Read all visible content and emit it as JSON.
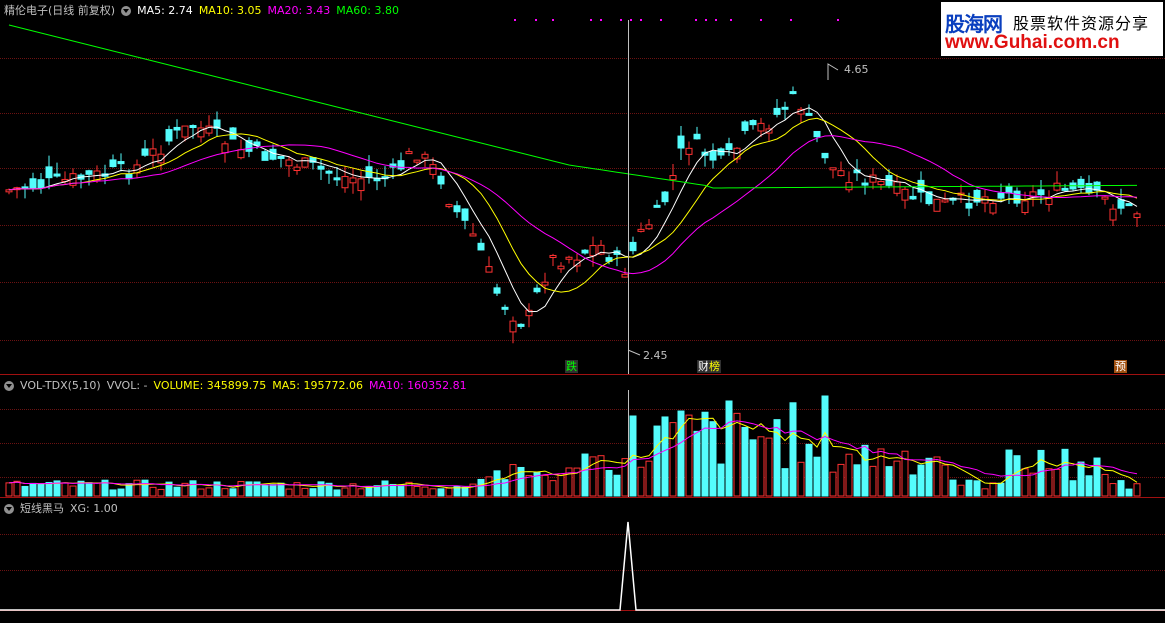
{
  "price_pane": {
    "stock_label": "精伦电子(日线 前复权)",
    "ma": [
      {
        "label": "MA5: 2.74",
        "color": "#ffffff"
      },
      {
        "label": "MA10: 3.05",
        "color": "#ffff00"
      },
      {
        "label": "MA20: 3.43",
        "color": "#ff00ff"
      },
      {
        "label": "MA60: 3.80",
        "color": "#00ff00"
      }
    ],
    "high_label": "4.65",
    "low_label": "2.45",
    "tags": [
      {
        "text": "跌",
        "color": "#00ff00"
      },
      {
        "text": "财",
        "color": "#ffffff"
      },
      {
        "text": "榜",
        "color": "#ffff00"
      },
      {
        "text": "预",
        "color": "#ffffff"
      }
    ]
  },
  "vol_pane": {
    "title": "VOL-TDX(5,10)",
    "vvol": "VVOL: -",
    "volume": "VOLUME: 345899.75",
    "ma5": "MA5: 195772.06",
    "ma10": "MA10: 160352.81",
    "colors": {
      "volume": "#ffff00",
      "ma5": "#ffff00",
      "ma10": "#ff00ff"
    }
  },
  "signal_pane": {
    "title": "短线黑马",
    "xg": "XG: 1.00"
  },
  "logo": {
    "brand_cn": "股海网",
    "tagline": "股票软件资源分享",
    "url": "www.Guhai.com.cn"
  },
  "colors": {
    "up": "#ff3232",
    "down": "#54fcfc",
    "grid": "#6b1212",
    "ma5": "#ffffff",
    "ma10": "#ffff00",
    "ma20": "#ff00ff",
    "ma60": "#00ff00"
  }
}
